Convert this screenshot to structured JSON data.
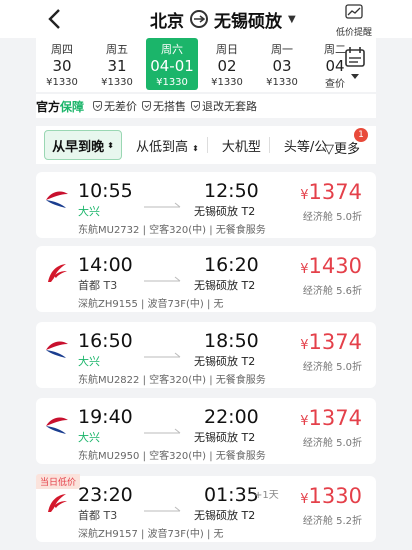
{
  "header": {
    "from": "北京",
    "to": "无锡硕放",
    "price_alert_label": "低价提醒"
  },
  "dates": [
    {
      "weekday": "周四",
      "date": "30",
      "price": "¥1330",
      "selected": false
    },
    {
      "weekday": "周五",
      "date": "31",
      "price": "¥1330",
      "selected": false
    },
    {
      "weekday": "周六",
      "date": "04-01",
      "price": "¥1330",
      "selected": true
    },
    {
      "weekday": "周日",
      "date": "02",
      "price": "¥1330",
      "selected": false
    },
    {
      "weekday": "周一",
      "date": "03",
      "price": "¥1330",
      "selected": false
    },
    {
      "weekday": "周二",
      "date": "04",
      "price": "查价",
      "selected": false
    }
  ],
  "guarantee": {
    "brand_a": "官方",
    "brand_b": "保障",
    "items": [
      "无差价",
      "无搭售",
      "退改无套路"
    ]
  },
  "filters": {
    "sort_time": "从早到晚",
    "sort_price": "从低到高",
    "aircraft": "大机型",
    "cabin": "头等/公",
    "more": "更多",
    "more_badge": "1"
  },
  "colors": {
    "accent": "#1bb56a",
    "price": "#e4404a"
  },
  "flights": [
    {
      "airline_icon": "china-eastern-logo",
      "dep_time": "10:55",
      "dep_airport": "大兴",
      "dep_highlight": true,
      "arr_time": "12:50",
      "arr_airport": "无锡硕放 T2",
      "plus_day": "",
      "info": "东航MU2732 | 空客320(中) | 无餐食服务",
      "price": "1374",
      "cabin": "经济舱 5.0折",
      "tag": ""
    },
    {
      "airline_icon": "shenzhen-airlines-logo",
      "dep_time": "14:00",
      "dep_airport": "首都 T3",
      "dep_highlight": false,
      "arr_time": "16:20",
      "arr_airport": "无锡硕放 T2",
      "plus_day": "",
      "info": "深航ZH9155 | 波音73F(中) | 无",
      "price": "1430",
      "cabin": "经济舱 5.6折",
      "tag": ""
    },
    {
      "airline_icon": "china-eastern-logo",
      "dep_time": "16:50",
      "dep_airport": "大兴",
      "dep_highlight": true,
      "arr_time": "18:50",
      "arr_airport": "无锡硕放 T2",
      "plus_day": "",
      "info": "东航MU2822 | 空客320(中) | 无餐食服务",
      "price": "1374",
      "cabin": "经济舱 5.0折",
      "tag": ""
    },
    {
      "airline_icon": "china-eastern-logo",
      "dep_time": "19:40",
      "dep_airport": "大兴",
      "dep_highlight": true,
      "arr_time": "22:00",
      "arr_airport": "无锡硕放 T2",
      "plus_day": "",
      "info": "东航MU2950 | 空客320(中) | 无餐食服务",
      "price": "1374",
      "cabin": "经济舱 5.0折",
      "tag": ""
    },
    {
      "airline_icon": "shenzhen-airlines-logo",
      "dep_time": "23:20",
      "dep_airport": "首都 T3",
      "dep_highlight": false,
      "arr_time": "01:35",
      "arr_airport": "无锡硕放 T2",
      "plus_day": "+1天",
      "info": "深航ZH9157 | 波音73F(中) | 无",
      "price": "1330",
      "cabin": "经济舱 5.2折",
      "tag": "当日低价"
    }
  ]
}
